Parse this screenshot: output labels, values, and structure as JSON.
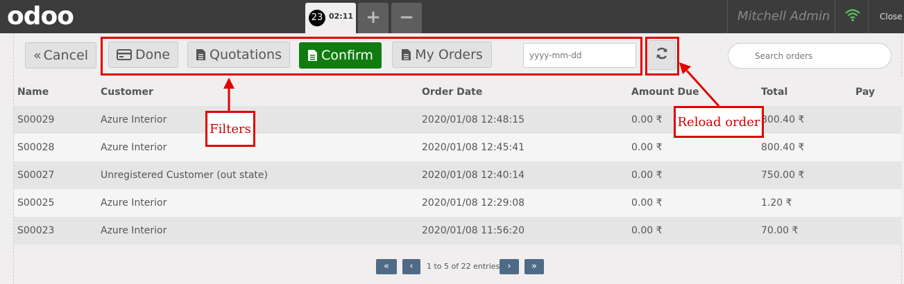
{
  "topbar": {
    "logo": "odoo",
    "order_number": "23",
    "order_time": "02:11",
    "add_tab": "+",
    "remove_tab": "−",
    "user": "Mitchell Admin",
    "close": "Close"
  },
  "toolbar": {
    "cancel": "Cancel",
    "done": "Done",
    "quotations": "Quotations",
    "confirm": "Confirm",
    "my_orders": "My Orders",
    "date_placeholder": "yyyy-mm-dd",
    "search_placeholder": "Search orders"
  },
  "table": {
    "headers": [
      "Name",
      "Customer",
      "Order Date",
      "Amount Due",
      "Total",
      "Pay"
    ],
    "rows": [
      [
        "S00029",
        "Azure Interior",
        "2020/01/08 12:48:15",
        "0.00 ₹",
        "800.40 ₹"
      ],
      [
        "S00028",
        "Azure Interior",
        "2020/01/08 12:45:41",
        "0.00 ₹",
        "800.40 ₹"
      ],
      [
        "S00027",
        "Unregistered Customer (out state)",
        "2020/01/08 12:40:14",
        "0.00 ₹",
        "750.00 ₹"
      ],
      [
        "S00025",
        "Azure Interior",
        "2020/01/08 12:29:08",
        "0.00 ₹",
        "1.20 ₹"
      ],
      [
        "S00023",
        "Azure Interior",
        "2020/01/08 11:56:20",
        "0.00 ₹",
        "70.00 ₹"
      ]
    ]
  },
  "pagination": {
    "first": "«",
    "prev": "‹",
    "info": "1 to 5 of 22 entries",
    "next": "›",
    "last": "»"
  },
  "annotations": {
    "filters": "Filters",
    "reload": "Reload order"
  },
  "colors": {
    "accent_green": "#107c10",
    "annotation_red": "#e00000",
    "topbar": "#3c3c3c",
    "wifi": "#5cb85c"
  },
  "icons": {
    "done": "credit-card-icon",
    "quotations": "file-icon",
    "confirm": "file-icon",
    "my_orders": "file-icon",
    "reload": "refresh-icon",
    "wifi": "wifi-icon"
  }
}
